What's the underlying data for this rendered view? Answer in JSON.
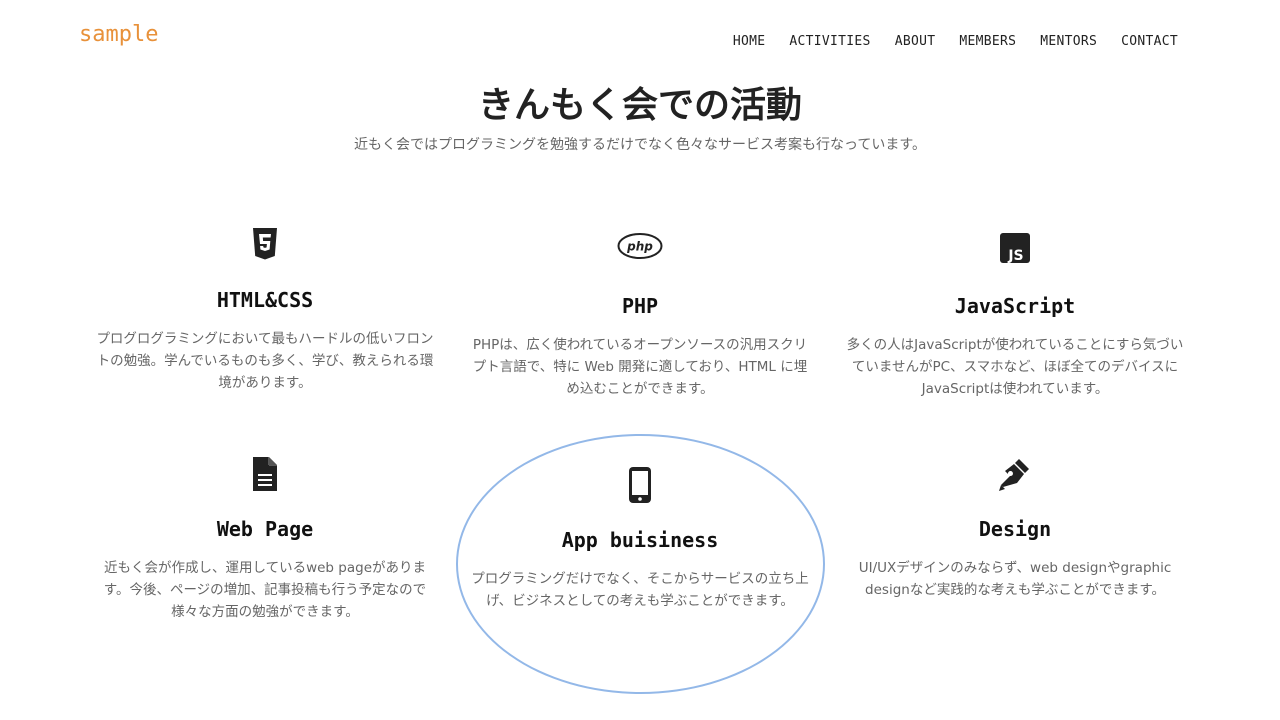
{
  "brand": "sample",
  "nav": {
    "items": [
      "HOME",
      "ACTIVITIES",
      "ABOUT",
      "MEMBERS",
      "MENTORS",
      "CONTACT"
    ]
  },
  "section": {
    "title": "きんもく会での活動",
    "subtitle": "近もく会ではプログラミングを勉強するだけでなく色々なサービス考案も行なっています。"
  },
  "features": [
    {
      "icon": "html5-icon",
      "title": "HTML&CSS",
      "text": "プログログラミングにおいて最もハードルの低いフロントの勉強。学んでいるものも多く、学び、教えられる環境があります。"
    },
    {
      "icon": "php-icon",
      "title": "PHP",
      "text": "PHPは、広く使われているオープンソースの汎用スクリプト言語で、特に Web 開発に適しており、HTML に埋め込むことができます。"
    },
    {
      "icon": "js-icon",
      "title": "JavaScript",
      "text": "多くの人はJavaScriptが使われていることにすら気づいていませんがPC、スマホなど、ほぼ全てのデバイスにJavaScriptは使われています。"
    },
    {
      "icon": "document-icon",
      "title": "Web Page",
      "text": "近もく会が作成し、運用しているweb pageがあります。今後、ページの増加、記事投稿も行う予定なので様々な方面の勉強ができます。"
    },
    {
      "icon": "mobile-phone-icon",
      "title": "App buisiness",
      "text": "プログラミングだけでなく、そこからサービスの立ち上げ、ビジネスとしての考えも学ぶことができます。"
    },
    {
      "icon": "pen-nib-icon",
      "title": "Design",
      "text": "UI/UXデザインのみならず、web designやgraphic designなど実践的な考えも学ぶことができます。"
    }
  ],
  "colors": {
    "brand": "#e8913a",
    "highlight": "#93b8e8",
    "text": "#222222",
    "muted": "#666666"
  }
}
